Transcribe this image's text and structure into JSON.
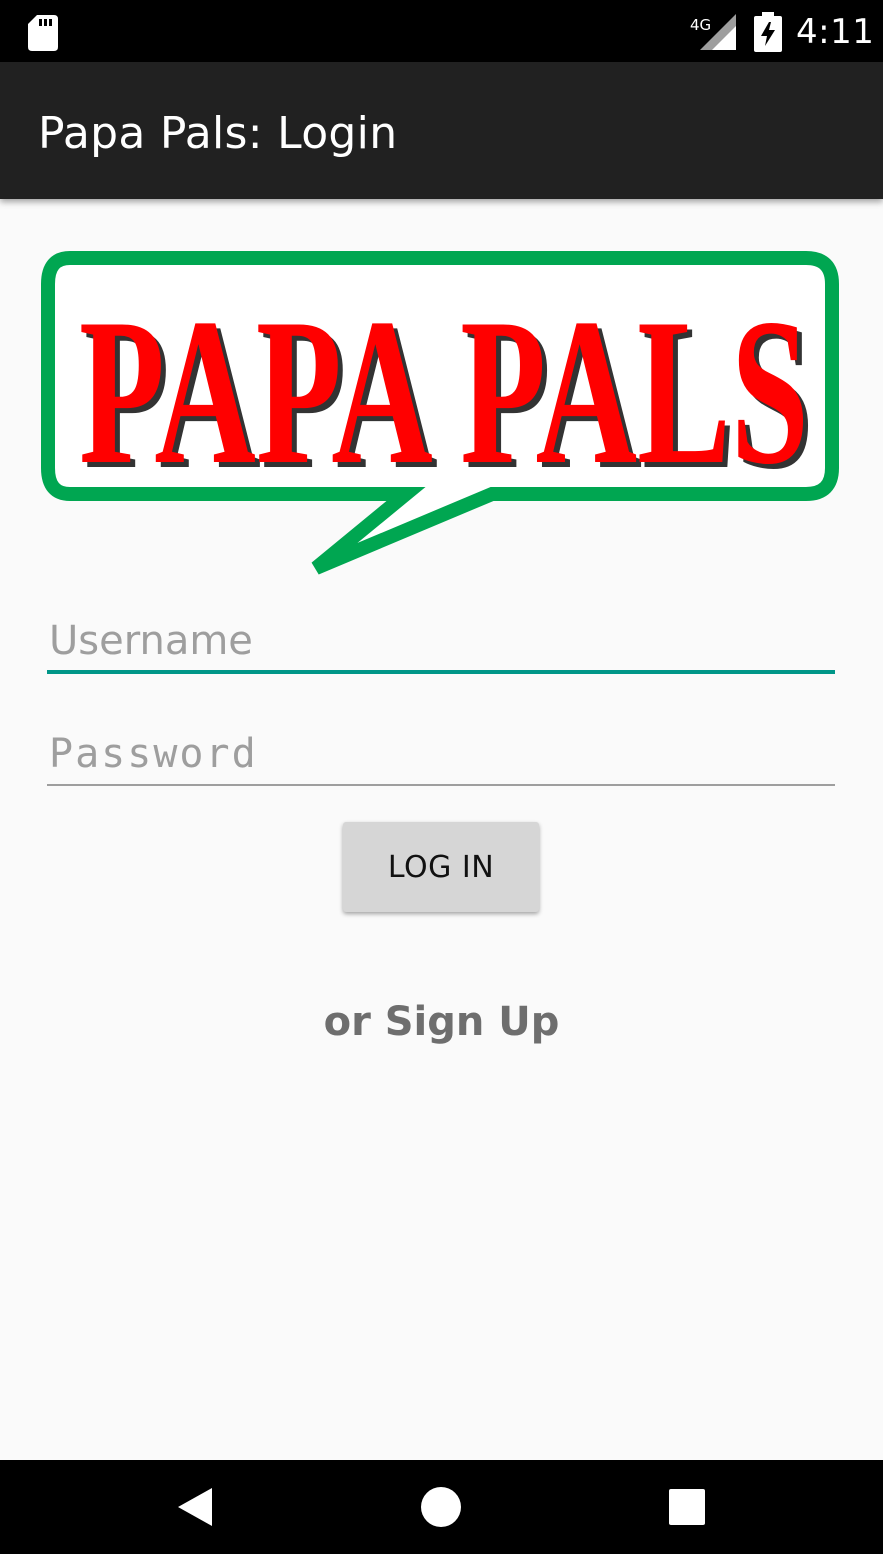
{
  "status_bar": {
    "time": "4:11",
    "network": "4G",
    "icons": [
      "sd-card-icon",
      "cell-signal-icon",
      "battery-charging-icon"
    ]
  },
  "app_bar": {
    "title": "Papa Pals: Login"
  },
  "logo": {
    "text": "PAPA PALS",
    "text_color": "#ff0000",
    "border_color": "#00a651"
  },
  "form": {
    "username_placeholder": "Username",
    "username_value": "",
    "password_placeholder": "Password",
    "password_value": "",
    "login_label": "LOG IN",
    "signup_label": "or Sign Up"
  },
  "nav_bar": {
    "icons": [
      "back-icon",
      "home-icon",
      "recents-icon"
    ]
  },
  "colors": {
    "accent": "#009688",
    "app_bar": "#212121",
    "background": "#fafafa"
  }
}
